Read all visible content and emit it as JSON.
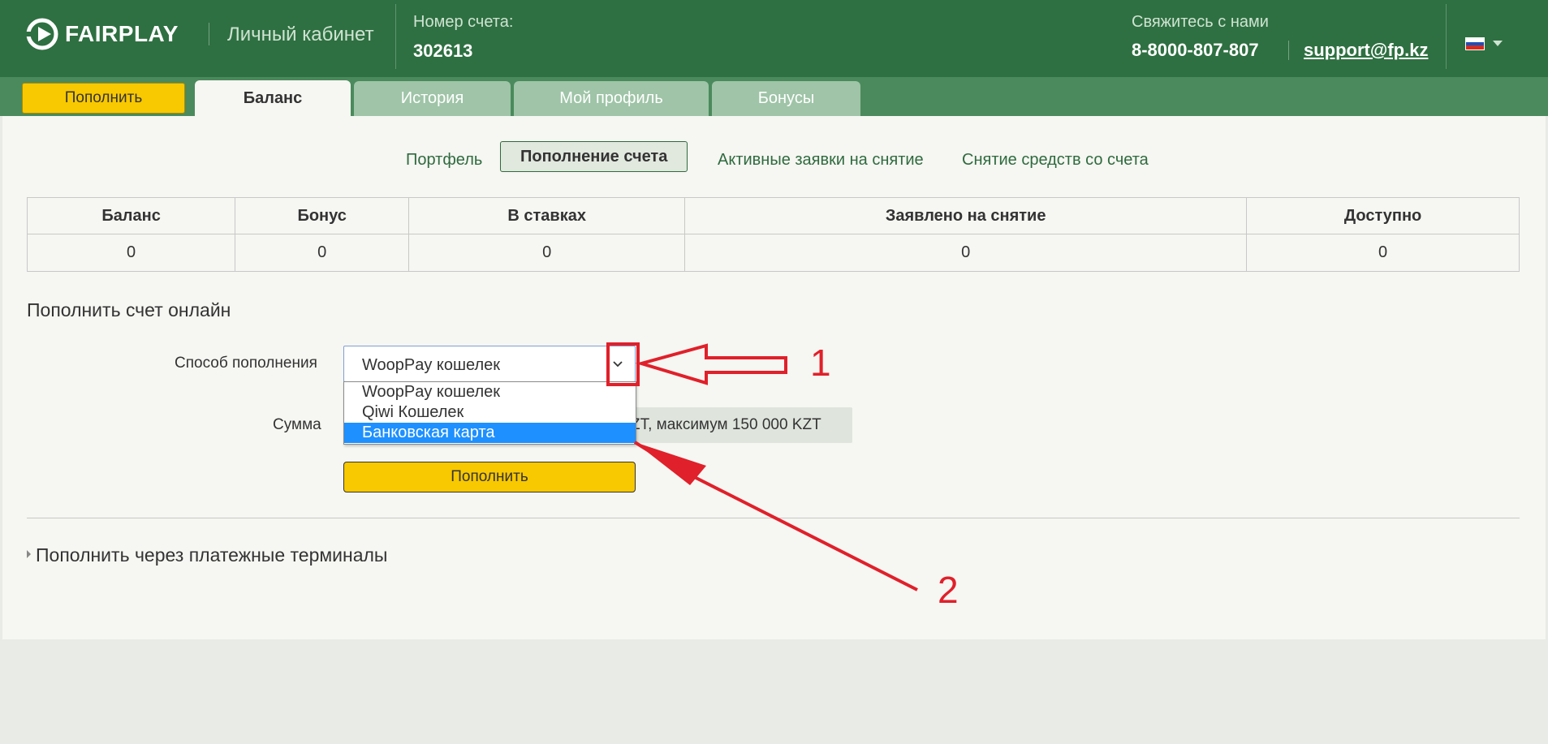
{
  "header": {
    "logo_text": "FAIRPLAY",
    "cabinet_label": "Личный кабинет",
    "account_label": "Номер счета:",
    "account_number": "302613",
    "contact_label": "Свяжитесь с нами",
    "phone": "8-8000-807-807",
    "email": "support@fp.kz",
    "language_icon": "flag-ru-icon"
  },
  "tabs": {
    "topup_button": "Пополнить",
    "items": [
      {
        "label": "Баланс",
        "active": true
      },
      {
        "label": "История",
        "active": false
      },
      {
        "label": "Мой профиль",
        "active": false
      },
      {
        "label": "Бонусы",
        "active": false
      }
    ]
  },
  "subnav": {
    "items": [
      {
        "label": "Портфель",
        "active": false
      },
      {
        "label": "Пополнение счета",
        "active": true
      },
      {
        "label": "Активные заявки на снятие",
        "active": false
      },
      {
        "label": "Снятие средств со счета",
        "active": false
      }
    ]
  },
  "balance_table": {
    "headers": [
      "Баланс",
      "Бонус",
      "В ставках",
      "Заявлено на снятие",
      "Доступно"
    ],
    "values": [
      "0",
      "0",
      "0",
      "0",
      "0"
    ]
  },
  "topup_form": {
    "title": "Пополнить счет онлайн",
    "method_label": "Способ пополнения",
    "method_value": "WoopPay кошелек",
    "method_options": [
      "WoopPay кошелек",
      "Qiwi Кошелек",
      "Банковская карта"
    ],
    "highlighted_option": "Банковская карта",
    "sum_label": "Сумма",
    "sum_hint": "ZT,  максимум 150 000 KZT",
    "submit_label": "Пополнить"
  },
  "terminals_label": "Пополнить через платежные терминалы",
  "annotations": {
    "label_1": "1",
    "label_2": "2"
  },
  "colors": {
    "header_green": "#2e7041",
    "tabbar_green": "#4a8a5c",
    "accent_yellow": "#f8c800",
    "annotation_red": "#e0202a",
    "highlight_blue": "#1e90ff"
  }
}
